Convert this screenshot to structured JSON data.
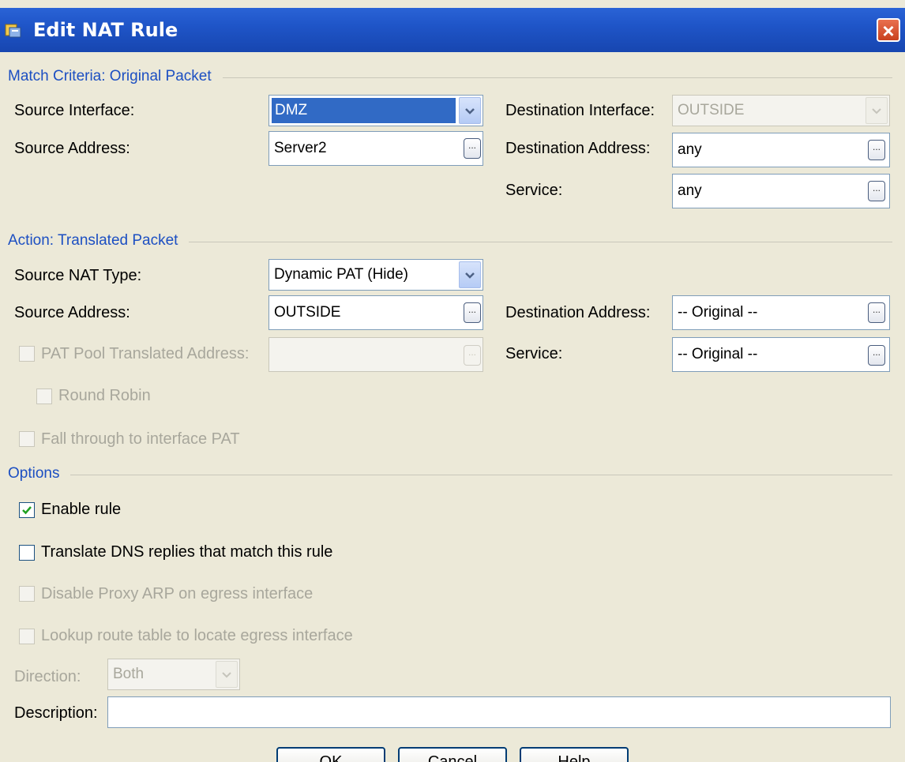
{
  "window": {
    "title": "Edit NAT Rule"
  },
  "match": {
    "section_label": "Match Criteria: Original Packet",
    "source_interface_label": "Source Interface:",
    "source_interface_value": "DMZ",
    "dest_interface_label": "Destination Interface:",
    "dest_interface_value": "OUTSIDE",
    "source_address_label": "Source Address:",
    "source_address_value": "Server2",
    "dest_address_label": "Destination Address:",
    "dest_address_value": "any",
    "service_label": "Service:",
    "service_value": "any"
  },
  "action": {
    "section_label": "Action: Translated Packet",
    "source_nat_type_label": "Source NAT Type:",
    "source_nat_type_value": "Dynamic PAT (Hide)",
    "source_address_label": "Source Address:",
    "source_address_value": "OUTSIDE",
    "dest_address_label": "Destination Address:",
    "dest_address_value": "-- Original --",
    "pat_pool_label": "PAT Pool Translated Address:",
    "pat_pool_value": "",
    "service_label": "Service:",
    "service_value": "-- Original --",
    "round_robin_label": "Round Robin",
    "fall_through_label": "Fall through to interface PAT"
  },
  "options": {
    "section_label": "Options",
    "enable_rule_label": "Enable rule",
    "enable_rule_checked": true,
    "translate_dns_label": "Translate DNS replies that match this rule",
    "disable_proxy_arp_label": "Disable Proxy ARP on egress interface",
    "lookup_route_label": "Lookup route table to locate egress interface",
    "direction_label": "Direction:",
    "direction_value": "Both",
    "description_label": "Description:",
    "description_value": ""
  },
  "buttons": {
    "ok": "OK",
    "cancel": "Cancel",
    "help": "Help"
  },
  "colors": {
    "titlebar": "#1f55c8",
    "section_label": "#1c4fc2",
    "dialog_bg": "#ece9d8"
  }
}
